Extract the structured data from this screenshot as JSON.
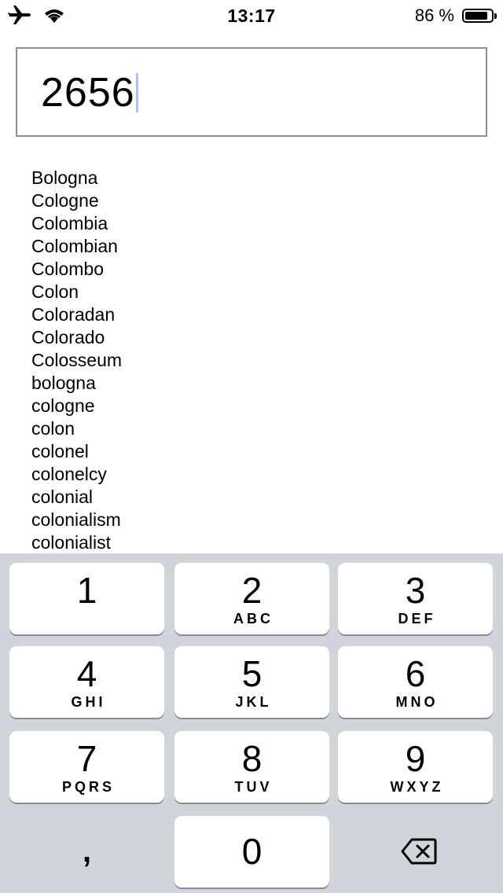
{
  "status_bar": {
    "time": "13:17",
    "battery_percent": "86 %",
    "battery_level": 0.86,
    "icons": [
      "airplane-icon",
      "wifi-icon",
      "battery-icon"
    ]
  },
  "input": {
    "value": "2656"
  },
  "suggestions": [
    "Bologna",
    "Cologne",
    "Colombia",
    "Colombian",
    "Colombo",
    "Colon",
    "Coloradan",
    "Colorado",
    "Colosseum",
    "bologna",
    "cologne",
    "colon",
    "colonel",
    "colonelcy",
    "colonial",
    "colonialism",
    "colonialist"
  ],
  "keypad": {
    "keys": [
      {
        "digit": "1",
        "letters": ""
      },
      {
        "digit": "2",
        "letters": "ABC"
      },
      {
        "digit": "3",
        "letters": "DEF"
      },
      {
        "digit": "4",
        "letters": "GHI"
      },
      {
        "digit": "5",
        "letters": "JKL"
      },
      {
        "digit": "6",
        "letters": "MNO"
      },
      {
        "digit": "7",
        "letters": "PQRS"
      },
      {
        "digit": "8",
        "letters": "TUV"
      },
      {
        "digit": "9",
        "letters": "WXYZ"
      },
      {
        "digit": "0",
        "letters": ""
      }
    ],
    "comma_label": ",",
    "delete_icon": "delete-backspace-icon",
    "background_color": "#d1d5db"
  }
}
